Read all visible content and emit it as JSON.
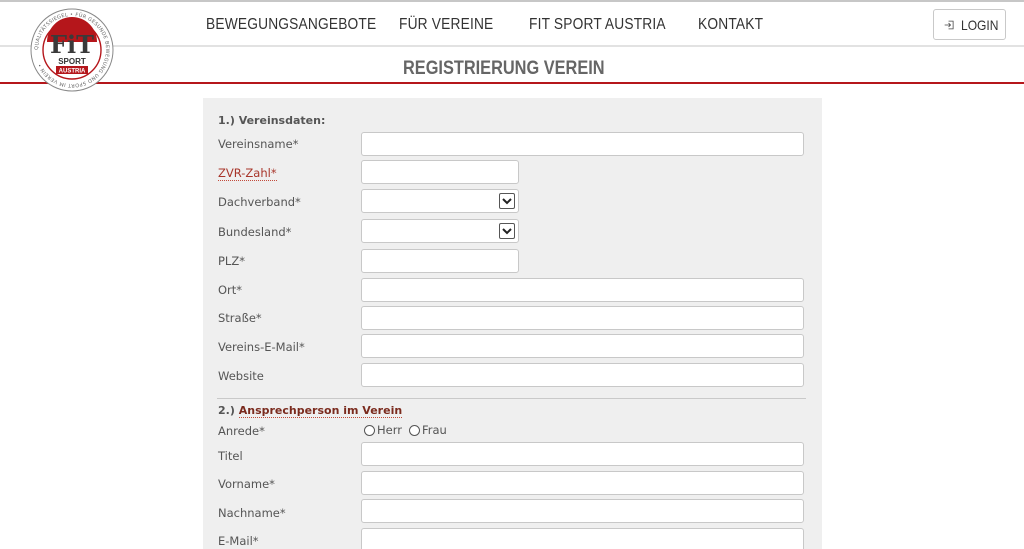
{
  "logo": {
    "main_text": "FiT",
    "badge_top": "SPORT",
    "badge_bottom": "AUSTRIA",
    "ring_text": "QUALITÄTSSIEGEL • FÜR GESUNDE BEWEGUNG UND SPORT IM VEREIN •"
  },
  "nav": {
    "items": [
      {
        "label": "BEWEGUNGSANGEBOTE"
      },
      {
        "label": "FÜR VEREINE"
      },
      {
        "label": "FIT SPORT AUSTRIA"
      },
      {
        "label": "KONTAKT"
      }
    ],
    "login_label": "LOGIN"
  },
  "page_title": "REGISTRIERUNG VEREIN",
  "colors": {
    "accent_red": "#b5161b",
    "panel_bg": "#efefef"
  },
  "section1": {
    "title": "1.) Vereinsdaten:",
    "fields": [
      {
        "label": "Vereinsname*",
        "value": ""
      },
      {
        "label": "ZVR-Zahl*",
        "value": ""
      },
      {
        "label": "Dachverband*",
        "value": ""
      },
      {
        "label": "Bundesland*",
        "value": ""
      },
      {
        "label": "PLZ*",
        "value": ""
      },
      {
        "label": "Ort*",
        "value": ""
      },
      {
        "label": "Straße*",
        "value": ""
      },
      {
        "label": "Vereins-E-Mail*",
        "value": ""
      },
      {
        "label": "Website",
        "value": ""
      }
    ]
  },
  "section2": {
    "title_prefix": "2.)",
    "title_highlight": "Ansprechperson im Verein",
    "anrede_label": "Anrede*",
    "anrede_options": [
      "Herr",
      "Frau"
    ],
    "fields": [
      {
        "label": "Titel",
        "value": ""
      },
      {
        "label": "Vorname*",
        "value": ""
      },
      {
        "label": "Nachname*",
        "value": ""
      },
      {
        "label": "E-Mail*",
        "value": ""
      }
    ]
  }
}
